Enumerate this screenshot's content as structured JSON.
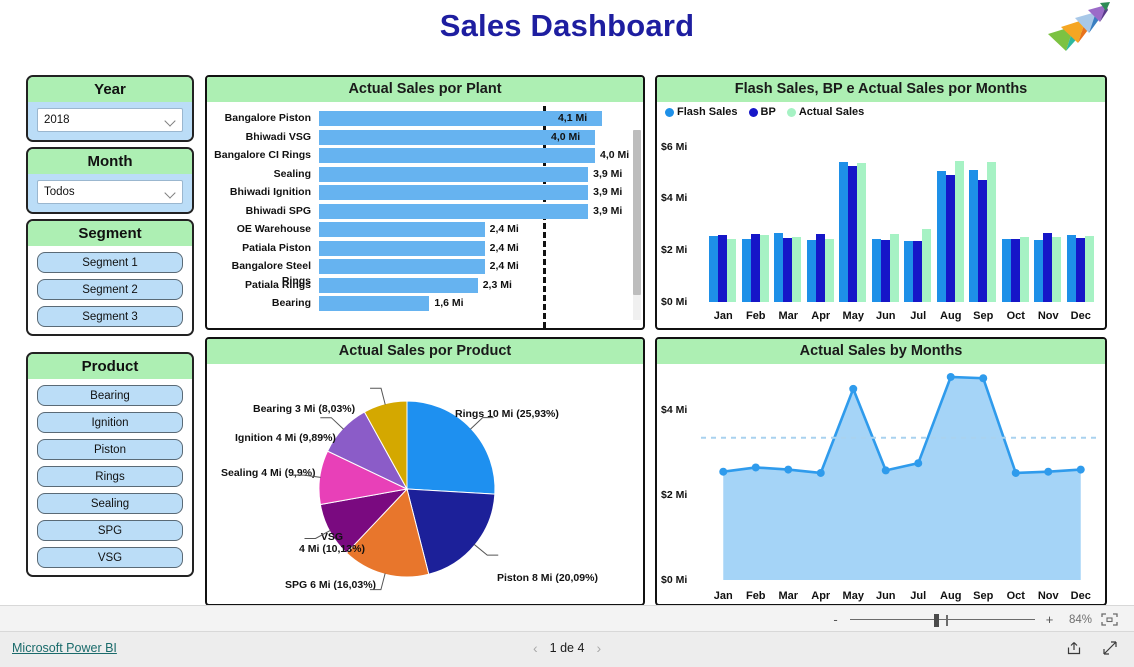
{
  "header": {
    "title": "Sales Dashboard",
    "logo_name": "company-arrow-logo",
    "title_color": "#1E1EA0"
  },
  "slicers": {
    "year": {
      "title": "Year",
      "value": "2018",
      "icon": "chevron-down-icon"
    },
    "month": {
      "title": "Month",
      "value": "Todos",
      "icon": "chevron-down-icon"
    },
    "segment": {
      "title": "Segment",
      "options": [
        "Segment 1",
        "Segment 2",
        "Segment 3"
      ]
    },
    "product": {
      "title": "Product",
      "options": [
        "Bearing",
        "Ignition",
        "Piston",
        "Rings",
        "Sealing",
        "SPG",
        "VSG"
      ]
    }
  },
  "cards": {
    "bar": "Actual Sales por Plant",
    "column": "Flash Sales, BP e Actual Sales por Months",
    "pie": "Actual Sales por Product",
    "area": "Actual Sales by Months"
  },
  "zoombar": {
    "minus": "-",
    "plus": "+",
    "percent": "84%",
    "fit_icon": "fit-to-page-icon"
  },
  "statusbar": {
    "brand": "Microsoft Power BI",
    "prev_icon": "chevron-left-icon",
    "next_icon": "chevron-right-icon",
    "page_text": "1 de 4",
    "share_icon": "share-icon",
    "fullscreen_icon": "fullscreen-icon"
  },
  "chart_data": [
    {
      "type": "bar",
      "title": "Actual Sales por Plant",
      "xlabel": "",
      "ylabel": "",
      "orientation": "horizontal",
      "grid": false,
      "legend": "none",
      "bar_color": "#66B3F0",
      "target_line": {
        "value": 3.25,
        "style": "dashed",
        "color": "#111111"
      },
      "xlim": [
        0,
        4.55
      ],
      "categories": [
        "Bangalore Piston",
        "Bhiwadi VSG",
        "Bangalore CI Rings",
        "Sealing",
        "Bhiwadi Ignition",
        "Bhiwadi SPG",
        "OE Warehouse",
        "Patiala Piston",
        "Bangalore Steel Rings",
        "Patiala Rings",
        "Bearing"
      ],
      "values": [
        4.1,
        4.0,
        4.0,
        3.9,
        3.9,
        3.9,
        2.4,
        2.4,
        2.4,
        2.3,
        1.6
      ],
      "labels": [
        "4,1 Mi",
        "4,0 Mi",
        "4,0 Mi",
        "3,9 Mi",
        "3,9 Mi",
        "3,9 Mi",
        "2,4 Mi",
        "2,4 Mi",
        "2,4 Mi",
        "2,3 Mi",
        "1,6 Mi"
      ],
      "labels_inside": [
        true,
        true,
        false,
        false,
        false,
        false,
        false,
        false,
        false,
        false,
        false
      ]
    },
    {
      "type": "bar",
      "title": "Flash Sales, BP e Actual Sales por Months",
      "orientation": "vertical",
      "xlabel": "",
      "ylabel": "",
      "grid": false,
      "legend_position": "top-left",
      "ylim": [
        0,
        6.6
      ],
      "yticks": [
        0,
        2,
        4,
        6
      ],
      "ytick_labels": [
        "$0 Mi",
        "$2 Mi",
        "$4 Mi",
        "$6 Mi"
      ],
      "categories": [
        "Jan",
        "Feb",
        "Mar",
        "Apr",
        "May",
        "Jun",
        "Jul",
        "Aug",
        "Sep",
        "Oct",
        "Nov",
        "Dec"
      ],
      "series": [
        {
          "name": "Flash Sales",
          "color": "#1E90E8",
          "values": [
            2.55,
            2.42,
            2.68,
            2.4,
            5.4,
            2.42,
            2.35,
            5.05,
            5.1,
            2.45,
            2.38,
            2.6
          ]
        },
        {
          "name": "BP",
          "color": "#1616C8",
          "values": [
            2.58,
            2.62,
            2.48,
            2.62,
            5.25,
            2.38,
            2.35,
            4.92,
            4.72,
            2.42,
            2.65,
            2.48
          ]
        },
        {
          "name": "Actual Sales",
          "color": "#A6F2C4",
          "values": [
            2.45,
            2.6,
            2.52,
            2.45,
            5.38,
            2.62,
            2.8,
            5.45,
            5.42,
            2.5,
            2.52,
            2.55
          ]
        }
      ]
    },
    {
      "type": "pie",
      "title": "Actual Sales por Product",
      "legend": "labels-outside",
      "labels": [
        "Rings 10 Mi (25,93%)",
        "Piston 8 Mi (20,09%)",
        "SPG 6 Mi (16,03%)",
        "VSG\n4 Mi (10,13%)",
        "Sealing 4 Mi (9,9%)",
        "Ignition 4 Mi (9,89%)",
        "Bearing 3 Mi (8,03%)"
      ],
      "categories": [
        "Rings",
        "Piston",
        "SPG",
        "VSG",
        "Sealing",
        "Ignition",
        "Bearing"
      ],
      "values": [
        25.93,
        20.09,
        16.03,
        10.13,
        9.9,
        9.89,
        8.03
      ],
      "amounts_mi": [
        10,
        8,
        6,
        4,
        4,
        4,
        3
      ],
      "colors": [
        "#1E90F0",
        "#1C2099",
        "#E8762C",
        "#7A0A80",
        "#E840B8",
        "#8B5CC8",
        "#D4A800"
      ]
    },
    {
      "type": "area",
      "title": "Actual Sales by Months",
      "xlabel": "",
      "ylabel": "",
      "grid": false,
      "legend": "none",
      "line_color": "#2F9BEC",
      "fill_color": "#A5D4F7",
      "ylim": [
        0,
        4.85
      ],
      "yticks": [
        0,
        2,
        4
      ],
      "ytick_labels": [
        "$0 Mi",
        "$2 Mi",
        "$4 Mi"
      ],
      "reference_line": {
        "value": 3.35,
        "style": "dashed",
        "color": "#A9D2EF"
      },
      "x": [
        "Jan",
        "Feb",
        "Mar",
        "Apr",
        "May",
        "Jun",
        "Jul",
        "Aug",
        "Sep",
        "Oct",
        "Nov",
        "Dec"
      ],
      "values": [
        2.55,
        2.65,
        2.6,
        2.52,
        4.5,
        2.58,
        2.75,
        4.78,
        4.75,
        2.52,
        2.55,
        2.6
      ]
    }
  ]
}
